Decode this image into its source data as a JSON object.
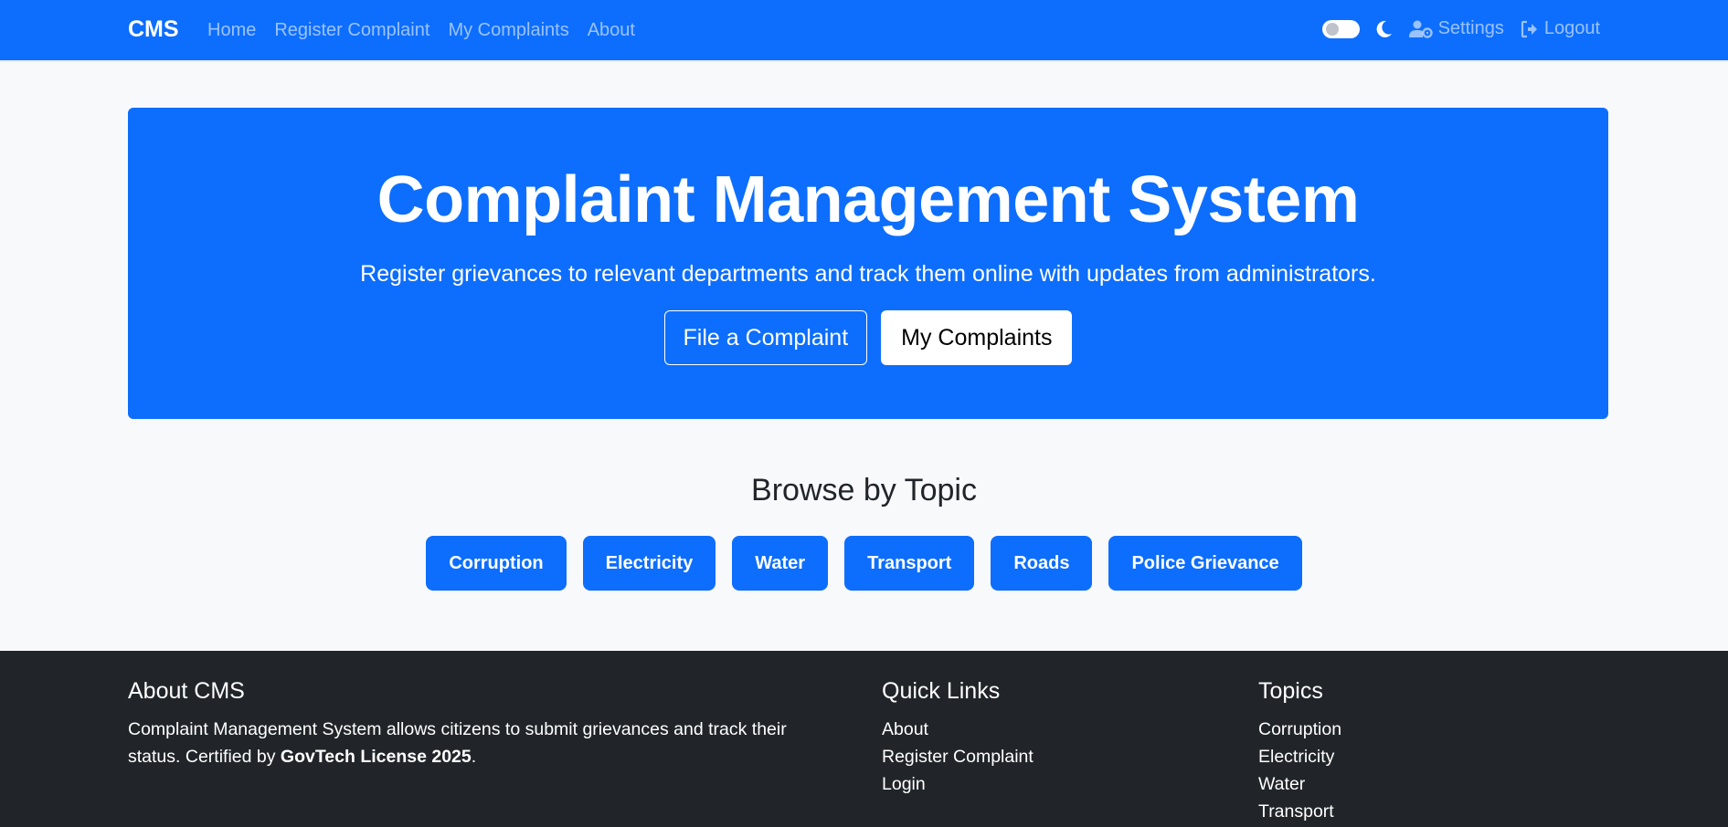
{
  "nav": {
    "brand": "CMS",
    "links": [
      "Home",
      "Register Complaint",
      "My Complaints",
      "About"
    ],
    "settings": "Settings",
    "logout": "Logout",
    "icons": [
      "toggle-switch",
      "moon-icon",
      "user-gear-icon",
      "logout-icon"
    ]
  },
  "hero": {
    "title": "Complaint Management System",
    "subtitle": "Register grievances to relevant departments and track them online with updates from administrators.",
    "file_btn": "File a Complaint",
    "my_btn": "My Complaints"
  },
  "topics": {
    "title": "Browse by Topic",
    "items": [
      "Corruption",
      "Electricity",
      "Water",
      "Transport",
      "Roads",
      "Police Grievance"
    ]
  },
  "footer": {
    "about": {
      "title": "About CMS",
      "text_before": "Complaint Management System allows citizens to submit grievances and track their status. Certified by ",
      "bold": "GovTech License 2025",
      "text_after": "."
    },
    "quick": {
      "title": "Quick Links",
      "items": [
        "About",
        "Register Complaint",
        "Login"
      ]
    },
    "topics": {
      "title": "Topics",
      "items": [
        "Corruption",
        "Electricity",
        "Water",
        "Transport"
      ]
    }
  },
  "colors": {
    "primary": "#0d6efd",
    "footer_bg": "#212529",
    "page_bg": "#f8f9fa"
  }
}
